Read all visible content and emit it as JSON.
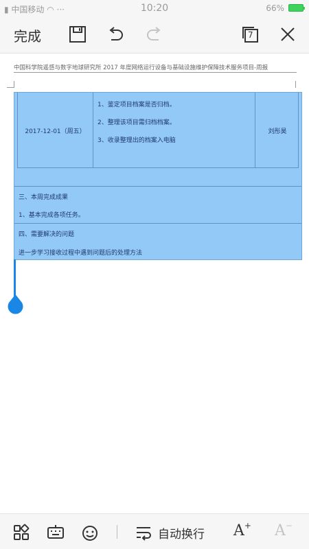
{
  "status_bar": {
    "carrier": "中国移动",
    "time": "10:20",
    "battery": "66%"
  },
  "toolbar": {
    "done_label": "完成",
    "page_count": "7"
  },
  "document": {
    "header_text": "中国科学院遥感与数字地球研究所 2017 年度网络运行设备与基础设施维护保障技术服务项目-周报",
    "table": {
      "date": "2017-12-01（周五）",
      "tasks": [
        "1、鉴定项目档案是否归档。",
        "2、整理该项目需归档档案。",
        "3、收录整理出的档案入电脑"
      ],
      "person": "刘彤昊"
    },
    "sections": {
      "completed_heading": "三、本周完成成果",
      "completed_body": "1、基本完成各项任务。",
      "issues_heading": "四、需要解决的问题",
      "issues_body": "进一步学习接收过程中遇到问题后的处理方法"
    }
  },
  "bottom_bar": {
    "wrap_label": "自动换行",
    "font_increase": "A",
    "font_decrease": "A"
  },
  "colors": {
    "table_fill": "#93c9f6",
    "cursor": "#1a86e6"
  }
}
